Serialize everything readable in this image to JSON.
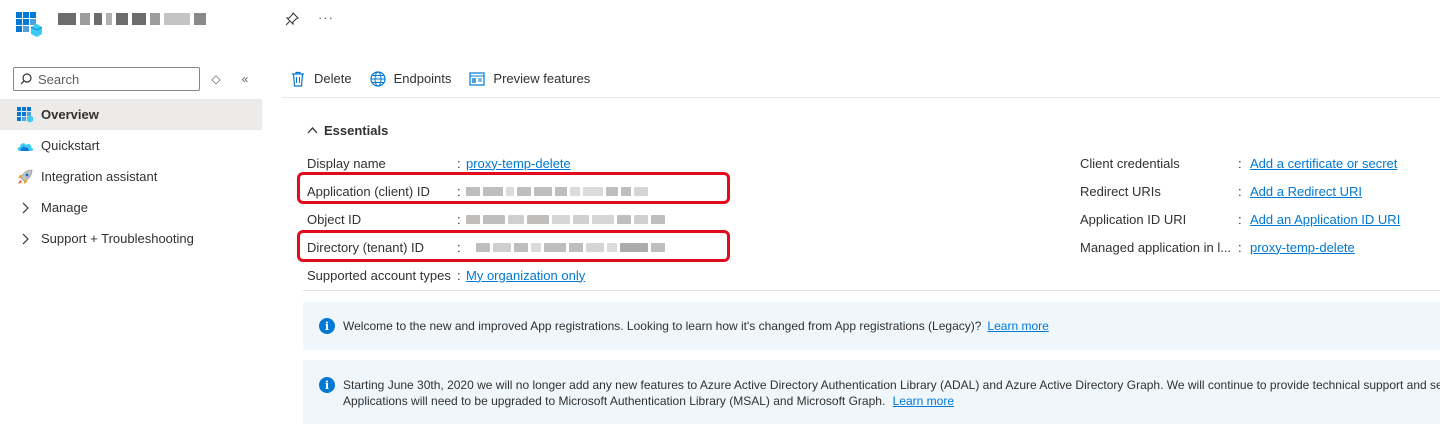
{
  "header": {
    "title_blurred": true,
    "pin_icon": "pin-icon",
    "more_label": "···"
  },
  "sidebar": {
    "search_placeholder": "Search",
    "filter_icon": "◇",
    "collapse_icon": "«",
    "items": [
      {
        "label": "Overview",
        "icon": "overview-icon",
        "active": true
      },
      {
        "label": "Quickstart",
        "icon": "quickstart-icon"
      },
      {
        "label": "Integration assistant",
        "icon": "rocket-icon"
      },
      {
        "label": "Manage",
        "icon": "chevron-right-icon"
      },
      {
        "label": "Support + Troubleshooting",
        "icon": "chevron-right-icon"
      }
    ]
  },
  "toolbar": {
    "delete_label": "Delete",
    "endpoints_label": "Endpoints",
    "preview_label": "Preview features"
  },
  "essentials": {
    "title": "Essentials",
    "left": [
      {
        "label": "Display name",
        "value": "proxy-temp-delete",
        "link": true
      },
      {
        "label": "Application (client) ID",
        "value": "",
        "blurred": true
      },
      {
        "label": "Object ID",
        "value": "",
        "blurred": true
      },
      {
        "label": "Directory (tenant) ID",
        "value": "",
        "blurred": true
      },
      {
        "label": "Supported account types",
        "value": "My organization only",
        "link": true
      }
    ],
    "right": [
      {
        "label": "Client credentials",
        "value": "Add a certificate or secret"
      },
      {
        "label": "Redirect URIs",
        "value": "Add a Redirect URI"
      },
      {
        "label": "Application ID URI",
        "value": "Add an Application ID URI"
      },
      {
        "label": "Managed application in l...",
        "value": "proxy-temp-delete"
      }
    ]
  },
  "banners": [
    {
      "text": "Welcome to the new and improved App registrations. Looking to learn how it's changed from App registrations (Legacy)?",
      "link": "Learn more"
    },
    {
      "line1": "Starting June 30th, 2020 we will no longer add any new features to Azure Active Directory Authentication Library (ADAL) and Azure Active Directory Graph. We will continue to provide technical support and se",
      "line2": "Applications will need to be upgraded to Microsoft Authentication Library (MSAL) and Microsoft Graph.",
      "link": "Learn more"
    }
  ],
  "colors": {
    "accent": "#0078d4",
    "highlight": "#e00b1c",
    "banner_bg": "#eff6fc"
  }
}
